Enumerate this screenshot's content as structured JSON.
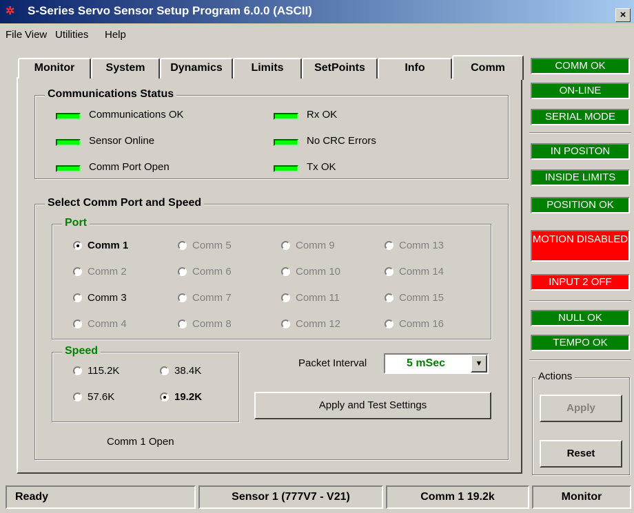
{
  "window": {
    "title": "S-Series Servo Sensor Setup Program 6.0.0 (ASCII)",
    "app_icon_glyph": "✲",
    "close_glyph": "×"
  },
  "menu": [
    "File",
    "View",
    "Utilities",
    "Help"
  ],
  "tabs": [
    {
      "label": "Monitor"
    },
    {
      "label": "System"
    },
    {
      "label": "Dynamics"
    },
    {
      "label": "Limits"
    },
    {
      "label": "SetPoints"
    },
    {
      "label": "Info"
    },
    {
      "label": "Comm",
      "active": true
    }
  ],
  "comm_status": {
    "title": "Communications Status",
    "items": [
      "Communications OK",
      "Sensor Online",
      "Comm Port Open",
      "Rx OK",
      "No CRC Errors",
      "Tx OK"
    ],
    "led_color": "#00ff00"
  },
  "comm_select": {
    "title": "Select Comm Port and Speed",
    "port_title": "Port",
    "ports": [
      {
        "label": "Comm 1",
        "checked": true,
        "enabled": true
      },
      {
        "label": "Comm 2",
        "checked": false,
        "enabled": false
      },
      {
        "label": "Comm 3",
        "checked": false,
        "enabled": true
      },
      {
        "label": "Comm 4",
        "checked": false,
        "enabled": false
      },
      {
        "label": "Comm 5",
        "checked": false,
        "enabled": false
      },
      {
        "label": "Comm 6",
        "checked": false,
        "enabled": false
      },
      {
        "label": "Comm 7",
        "checked": false,
        "enabled": false
      },
      {
        "label": "Comm 8",
        "checked": false,
        "enabled": false
      },
      {
        "label": "Comm 9",
        "checked": false,
        "enabled": false
      },
      {
        "label": "Comm 10",
        "checked": false,
        "enabled": false
      },
      {
        "label": "Comm 11",
        "checked": false,
        "enabled": false
      },
      {
        "label": "Comm 12",
        "checked": false,
        "enabled": false
      },
      {
        "label": "Comm 13",
        "checked": false,
        "enabled": false
      },
      {
        "label": "Comm 14",
        "checked": false,
        "enabled": false
      },
      {
        "label": "Comm 15",
        "checked": false,
        "enabled": false
      },
      {
        "label": "Comm 16",
        "checked": false,
        "enabled": false
      }
    ],
    "speed_title": "Speed",
    "speeds": [
      {
        "label": "115.2K",
        "checked": false
      },
      {
        "label": "38.4K",
        "checked": false
      },
      {
        "label": "57.6K",
        "checked": false
      },
      {
        "label": "19.2K",
        "checked": true
      }
    ],
    "packet_interval_label": "Packet Interval",
    "packet_interval_value": "5 mSec",
    "packet_interval_color": "#008000",
    "apply_test_label": "Apply and Test Settings",
    "port_status": "Comm 1 Open"
  },
  "indicators": [
    {
      "label": "COMM OK",
      "color": "#008000"
    },
    {
      "label": "ON-LINE",
      "color": "#008000"
    },
    {
      "label": "SERIAL MODE",
      "color": "#008000"
    },
    {
      "label": "IN POSITON",
      "color": "#008000"
    },
    {
      "label": "INSIDE LIMITS",
      "color": "#008000"
    },
    {
      "label": "POSITION OK",
      "color": "#008000"
    },
    {
      "label": "MOTION DISABLED",
      "color": "#ff0000"
    },
    {
      "label": "INPUT 2 OFF",
      "color": "#ff0000"
    },
    {
      "label": "NULL OK",
      "color": "#008000"
    },
    {
      "label": "TEMPO OK",
      "color": "#008000"
    }
  ],
  "actions": {
    "title": "Actions",
    "apply_label": "Apply",
    "reset_label": "Reset"
  },
  "statusbar": [
    "Ready",
    "Sensor 1  (777V7 - V21)",
    "Comm 1 19.2k",
    "Monitor"
  ]
}
